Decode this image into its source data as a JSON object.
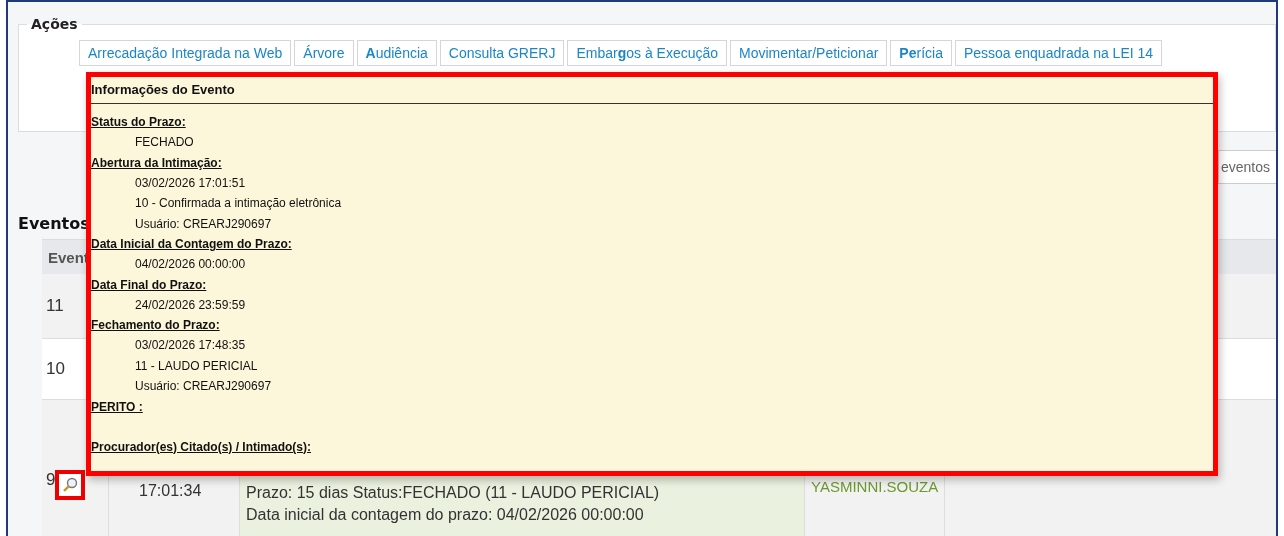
{
  "actions": {
    "title": "Ações",
    "links": [
      {
        "label": "Arrecadação Integrada na Web"
      },
      {
        "label": "Árvore"
      },
      {
        "label": "**A**udiência"
      },
      {
        "label": "Consulta GRERJ"
      },
      {
        "label": "Embar**g**os à Execução"
      },
      {
        "label": "Movimentar/Peticionar"
      },
      {
        "label": "**Pe**rícia"
      },
      {
        "label": "Pessoa enquadrada na LEI 14"
      }
    ]
  },
  "events_search": {
    "placeholder": "eventos"
  },
  "events": {
    "title": "Eventos",
    "columns": [
      "Event"
    ],
    "rows": [
      {
        "number": "11",
        "highlighted": false,
        "time": "",
        "lines": [],
        "user": ""
      },
      {
        "number": "10",
        "highlighted": false,
        "time": "",
        "lines": [],
        "user": ""
      },
      {
        "number": "9",
        "highlighted": true,
        "time": "17:01:34",
        "lines": [
          "Prazo: 15 dias Status:FECHADO (11 - LAUDO PERICIAL)",
          "Data inicial da contagem do prazo: 04/02/2026 00:00:00"
        ],
        "user": "YASMINNI.SOUZA"
      }
    ]
  },
  "popup": {
    "title": "Informações do Evento",
    "sections": [
      {
        "label": "Status do Prazo:",
        "values": [
          "FECHADO"
        ]
      },
      {
        "label": "Abertura da Intimação:",
        "values": [
          "03/02/2026 17:01:51",
          "10 - Confirmada a intimação eletrônica",
          "Usuário: CREARJ290697"
        ]
      },
      {
        "label": "Data Inicial da Contagem do Prazo:",
        "values": [
          "04/02/2026 00:00:00"
        ]
      },
      {
        "label": "Data Final do Prazo:",
        "values": [
          "24/02/2026 23:59:59"
        ]
      },
      {
        "label": "Fechamento do Prazo:",
        "values": [
          "03/02/2026 17:48:35",
          "11 - LAUDO PERICIAL",
          "Usuário: CREARJ290697"
        ]
      },
      {
        "label": "PERITO :"
      },
      {
        "label": "Procurador(es) Citado(s) / Intimado(s):"
      }
    ]
  }
}
